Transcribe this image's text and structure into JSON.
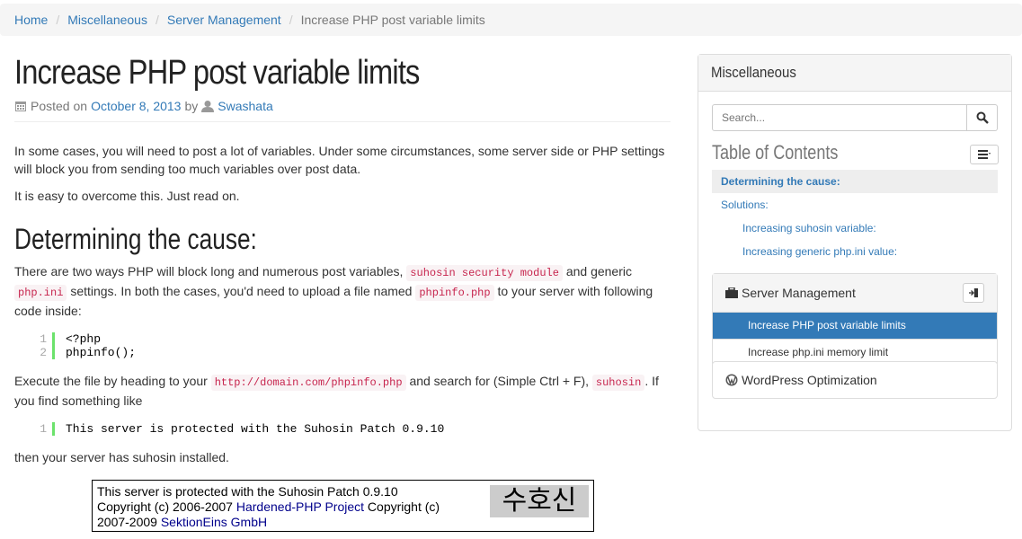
{
  "breadcrumb": {
    "home": "Home",
    "misc": "Miscellaneous",
    "server": "Server Management",
    "current": "Increase PHP post variable limits"
  },
  "article": {
    "title": "Increase PHP post variable limits",
    "posted_on": "Posted on",
    "date": "October 8, 2013",
    "by": "by",
    "author": "Swashata",
    "p1": "In some cases, you will need to post a lot of variables. Under some circumstances, some server side or PHP settings will block you from sending too much variables over post data.",
    "p2": "It is easy to overcome this. Just read on.",
    "h2": "Determining the cause:",
    "p3_a": "There are two ways PHP will block long and numerous post variables,",
    "p3_code1": "suhosin security module",
    "p3_b": "and generic",
    "p3_code2": "php.ini",
    "p3_c": "settings. In both the cases, you'd need to upload a file named",
    "p3_code3": "phpinfo.php",
    "p3_d": "to your server with following code inside:",
    "code1_nums": [
      "1",
      "2"
    ],
    "code1_lines": [
      "<?php",
      "phpinfo();"
    ],
    "p4_a": "Execute the file by heading to your",
    "p4_code1": "http://domain.com/phpinfo.php",
    "p4_b": "and search for (Simple Ctrl + F),",
    "p4_code2": "suhosin",
    "p4_c": ". If you find something like",
    "code2_num": "1",
    "code2_line": "This server is protected with the Suhosin Patch 0.9.10",
    "p5": "then your server has suhosin installed.",
    "suhosin_line1": "This server is protected with the Suhosin Patch 0.9.10",
    "suhosin_line2a": "Copyright (c) 2006-2007",
    "suhosin_link1": "Hardened-PHP Project",
    "suhosin_line2b": "Copyright (c)",
    "suhosin_line3a": "2007-2009",
    "suhosin_link2": "SektionEins GmbH",
    "suhosin_logo": "수호신"
  },
  "sidebar": {
    "heading": "Miscellaneous",
    "search_placeholder": "Search...",
    "toc_title": "Table of Contents",
    "toc": [
      {
        "label": "Determining the cause:"
      },
      {
        "label": "Solutions:"
      },
      {
        "label": "Increasing suhosin variable:"
      },
      {
        "label": "Increasing generic php.ini value:"
      }
    ],
    "server_panel": {
      "title": "Server Management",
      "items": [
        "Increase PHP post variable limits",
        "Increase php.ini memory limit"
      ]
    },
    "wp_panel": {
      "title": "WordPress Optimization"
    }
  },
  "colors": {
    "link": "#337ab7",
    "active": "#337ab7",
    "code": "#c7254e",
    "code_bar": "#6ce26c"
  }
}
